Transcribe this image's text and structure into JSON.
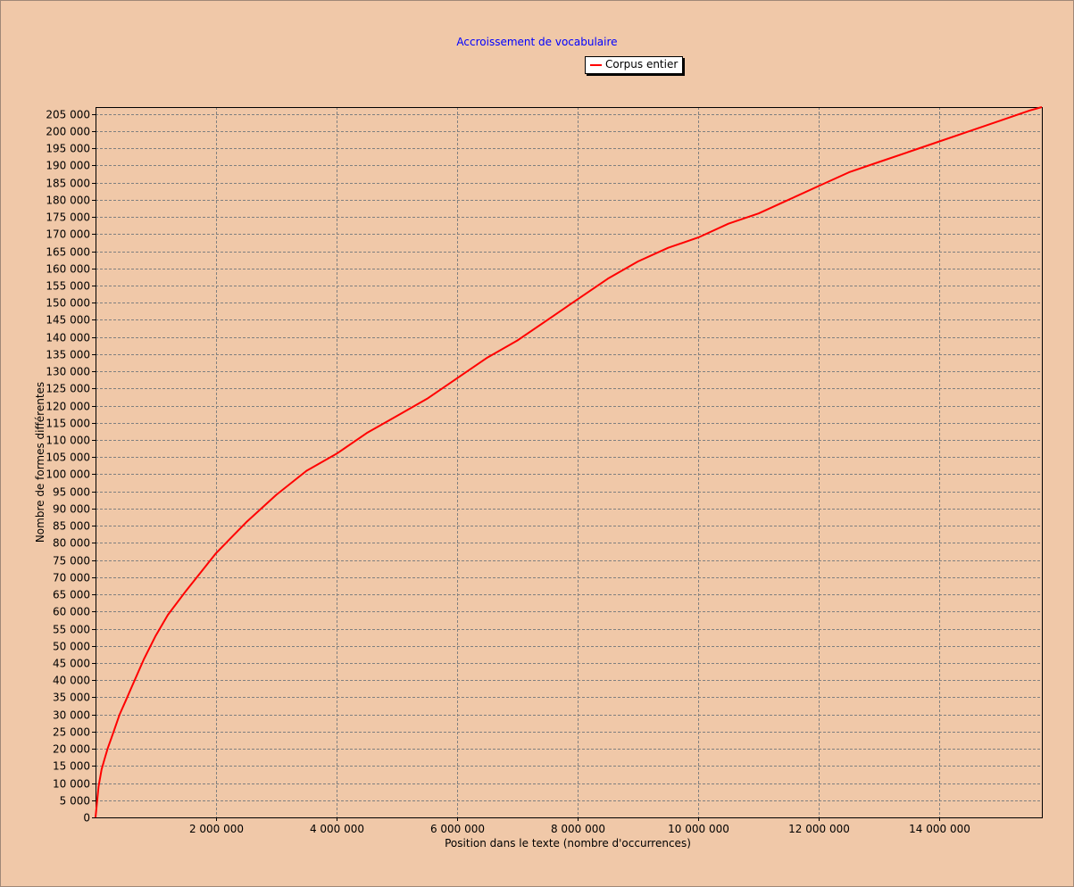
{
  "chart_data": {
    "type": "line",
    "title": "Accroissement de vocabulaire",
    "xlabel": "Position dans le texte (nombre d'occurrences)",
    "ylabel": "Nombre de formes différentes",
    "xlim": [
      0,
      15700000
    ],
    "ylim": [
      0,
      207000
    ],
    "x_ticks": [
      2000000,
      4000000,
      6000000,
      8000000,
      10000000,
      12000000,
      14000000
    ],
    "x_tick_labels": [
      "2 000 000",
      "4 000 000",
      "6 000 000",
      "8 000 000",
      "10 000 000",
      "12 000 000",
      "14 000 000"
    ],
    "y_ticks": [
      0,
      5000,
      10000,
      15000,
      20000,
      25000,
      30000,
      35000,
      40000,
      45000,
      50000,
      55000,
      60000,
      65000,
      70000,
      75000,
      80000,
      85000,
      90000,
      95000,
      100000,
      105000,
      110000,
      115000,
      120000,
      125000,
      130000,
      135000,
      140000,
      145000,
      150000,
      155000,
      160000,
      165000,
      170000,
      175000,
      180000,
      185000,
      190000,
      195000,
      200000,
      205000
    ],
    "y_tick_labels": [
      "0",
      "5 000",
      "10 000",
      "15 000",
      "20 000",
      "25 000",
      "30 000",
      "35 000",
      "40 000",
      "45 000",
      "50 000",
      "55 000",
      "60 000",
      "65 000",
      "70 000",
      "75 000",
      "80 000",
      "85 000",
      "90 000",
      "95 000",
      "100 000",
      "105 000",
      "110 000",
      "115 000",
      "120 000",
      "125 000",
      "130 000",
      "135 000",
      "140 000",
      "145 000",
      "150 000",
      "155 000",
      "160 000",
      "165 000",
      "170 000",
      "175 000",
      "180 000",
      "185 000",
      "190 000",
      "195 000",
      "200 000",
      "205 000"
    ],
    "grid": true,
    "legend_position": "top-center",
    "series": [
      {
        "name": "Corpus entier",
        "color": "#ff0000",
        "x": [
          0,
          50000,
          100000,
          150000,
          200000,
          300000,
          400000,
          500000,
          600000,
          800000,
          1000000,
          1200000,
          1500000,
          2000000,
          2500000,
          3000000,
          3500000,
          4000000,
          4500000,
          5000000,
          5500000,
          6000000,
          6500000,
          7000000,
          7500000,
          8000000,
          8500000,
          9000000,
          9500000,
          10000000,
          10500000,
          11000000,
          11500000,
          12000000,
          12500000,
          13000000,
          13500000,
          14000000,
          14500000,
          15000000,
          15500000,
          15700000
        ],
        "y": [
          0,
          9000,
          14000,
          17000,
          20000,
          25000,
          30000,
          34000,
          38000,
          46000,
          53000,
          59000,
          66000,
          77000,
          86000,
          94000,
          101000,
          106000,
          112000,
          117000,
          122000,
          128000,
          134000,
          139000,
          145000,
          151000,
          157000,
          162000,
          166000,
          169000,
          173000,
          176000,
          180000,
          184000,
          188000,
          191000,
          194000,
          197000,
          200000,
          203000,
          206000,
          207000
        ]
      }
    ]
  }
}
